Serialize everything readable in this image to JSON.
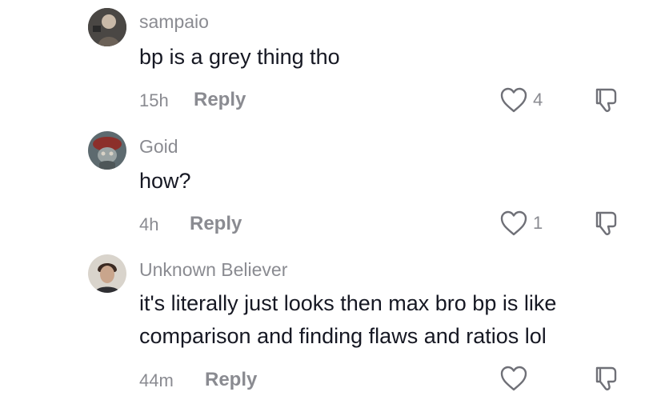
{
  "comments": [
    {
      "username": "sampaio",
      "text_lines": [
        "bp is a grey thing tho"
      ],
      "time": "15h",
      "reply_label": "Reply",
      "likes": "4",
      "avatar_colors": [
        "#3a3a3a",
        "#c9b9a8",
        "#6b6157"
      ]
    },
    {
      "username": "Goid",
      "text_lines": [
        "how?"
      ],
      "time": "4h",
      "reply_label": "Reply",
      "likes": "1",
      "avatar_colors": [
        "#5d6a6f",
        "#8c2f2a",
        "#d8d2c6"
      ]
    },
    {
      "username": "Unknown Believer",
      "text_lines": [
        "it's literally just looks then max bro bp is like",
        "comparison and finding flaws and ratios lol"
      ],
      "time": "44m",
      "reply_label": "Reply",
      "likes": "",
      "avatar_colors": [
        "#d9d4cc",
        "#3b2a22",
        "#c9a58c"
      ]
    }
  ],
  "icons": {
    "like": "heart-outline-icon",
    "dislike": "thumbs-down-outline-icon"
  }
}
